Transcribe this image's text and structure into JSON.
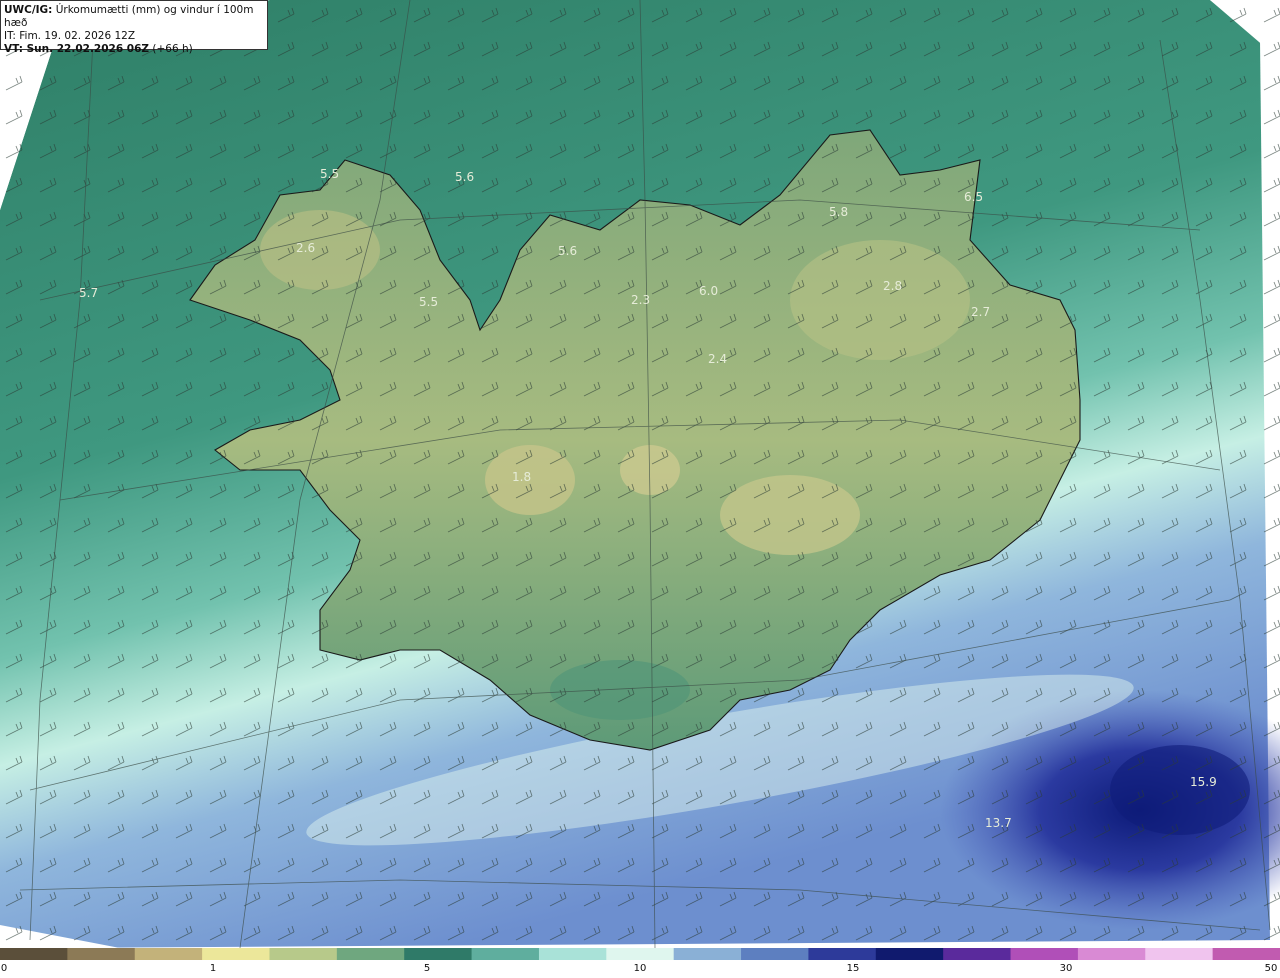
{
  "header": {
    "model": "UWC/IG:",
    "title": "Úrkomumætti (mm) og vindur í 100m hæð",
    "it_label": "IT:",
    "it_value": "Fim. 19. 02. 2026 12Z",
    "vt_label": "VT: Sun. 22.02.2026 06Z",
    "vt_lead": "(+66 h)"
  },
  "map_values": [
    "5.5",
    "5.6",
    "2.6",
    "5.7",
    "5.5",
    "5.6",
    "2.3",
    "6.0",
    "2.4",
    "5.8",
    "6.5",
    "2.8",
    "2.7",
    "1.8",
    "15.9",
    "13.7"
  ],
  "colorbar": {
    "ticks": [
      "0",
      "1",
      "5",
      "10",
      "15",
      "30",
      "50"
    ],
    "colors": [
      "#5b4f3a",
      "#8c7a56",
      "#c3b27a",
      "#ece79a",
      "#b7c98a",
      "#6fa77f",
      "#2f7a68",
      "#5fae9e",
      "#a9e2d8",
      "#dff6ee",
      "#8ab0d6",
      "#5d7fc0",
      "#2d3a9a",
      "#101a6e",
      "#5a2a9c",
      "#b04fb8",
      "#d98ad4",
      "#f0c4ee",
      "#c15bb0"
    ]
  }
}
